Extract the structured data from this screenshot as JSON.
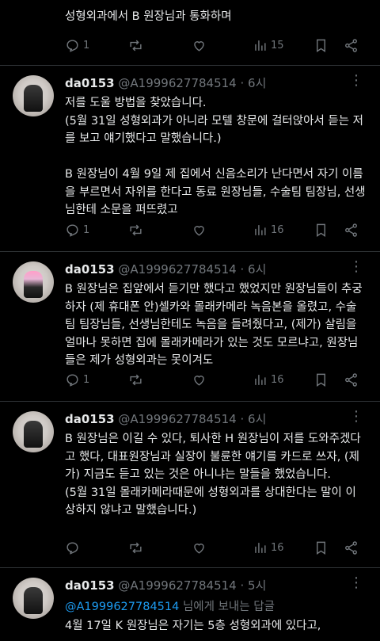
{
  "posts": [
    {
      "text": "성형외과에서 B 원장님과 통화하며",
      "stats": {
        "reply": "1",
        "repost": "",
        "like": "",
        "views": "15"
      }
    },
    {
      "name": "da0153",
      "handle": "@A1999627784514",
      "time": "· 6시",
      "text": "저를 도울 방법을 찾았습니다.\n(5월 31일 성형외과가 아니라 모텔 창문에 걸터앉아서 듣는 저를 보고 얘기했다고 말했습니다.)\n\nB 원장님이 4월 9일 제 집에서 신음소리가 난다면서 자기 이름을 부르면서 자위를 한다고 동료 원장님들, 수술팀 팀장님, 선생님한테 소문을 퍼뜨렸고",
      "stats": {
        "reply": "1",
        "repost": "",
        "like": "",
        "views": "16"
      }
    },
    {
      "name": "da0153",
      "handle": "@A1999627784514",
      "time": "· 6시",
      "text": "B 원장님은 집앞에서 듣기만 했다고 했었지만 원장님들이 추궁하자 (제 휴대폰 안)셀카와 몰래카메라 녹음본을 올렸고, 수술팀 팀장님들, 선생님한테도 녹음을 들려줬다고, (제가) 살림을 얼마나 못하면 집에 몰래카메라가 있는 것도 모르냐고, 원장님들은 제가 성형외과는 못이겨도",
      "stats": {
        "reply": "1",
        "repost": "",
        "like": "",
        "views": "16"
      }
    },
    {
      "name": "da0153",
      "handle": "@A1999627784514",
      "time": "· 6시",
      "text": "B 원장님은 이길 수 있다, 퇴사한 H 원장님이 저를 도와주겠다고 했다, 대표원장님과 실장이 불륜한 얘기를 카드로 쓰자, (제가) 지금도 듣고 있는 것은 아니냐는 말들을 했었습니다.\n(5월 31일 몰래카메라때문에 성형외과를 상대한다는 말이 이상하지 않냐고 말했습니다.)",
      "stats": {
        "reply": "",
        "repost": "",
        "like": "",
        "views": "16"
      }
    },
    {
      "name": "da0153",
      "handle": "@A1999627784514",
      "time": "· 5시",
      "reply_mention": "@A1999627784514",
      "reply_suffix": " 님에게 보내는 답글",
      "text": "4월 17일 K 원장님은 자기는 5층 성형외과에 있다고,"
    }
  ],
  "icons": {
    "more": "more-dots-icon",
    "reply": "reply-icon",
    "repost": "repost-icon",
    "like": "like-icon",
    "views": "views-icon",
    "bookmark": "bookmark-icon",
    "share": "share-icon"
  },
  "colors": {
    "accent": "#1d9bf0",
    "muted": "#71767b",
    "text": "#e7e9ea",
    "background": "#000000"
  }
}
